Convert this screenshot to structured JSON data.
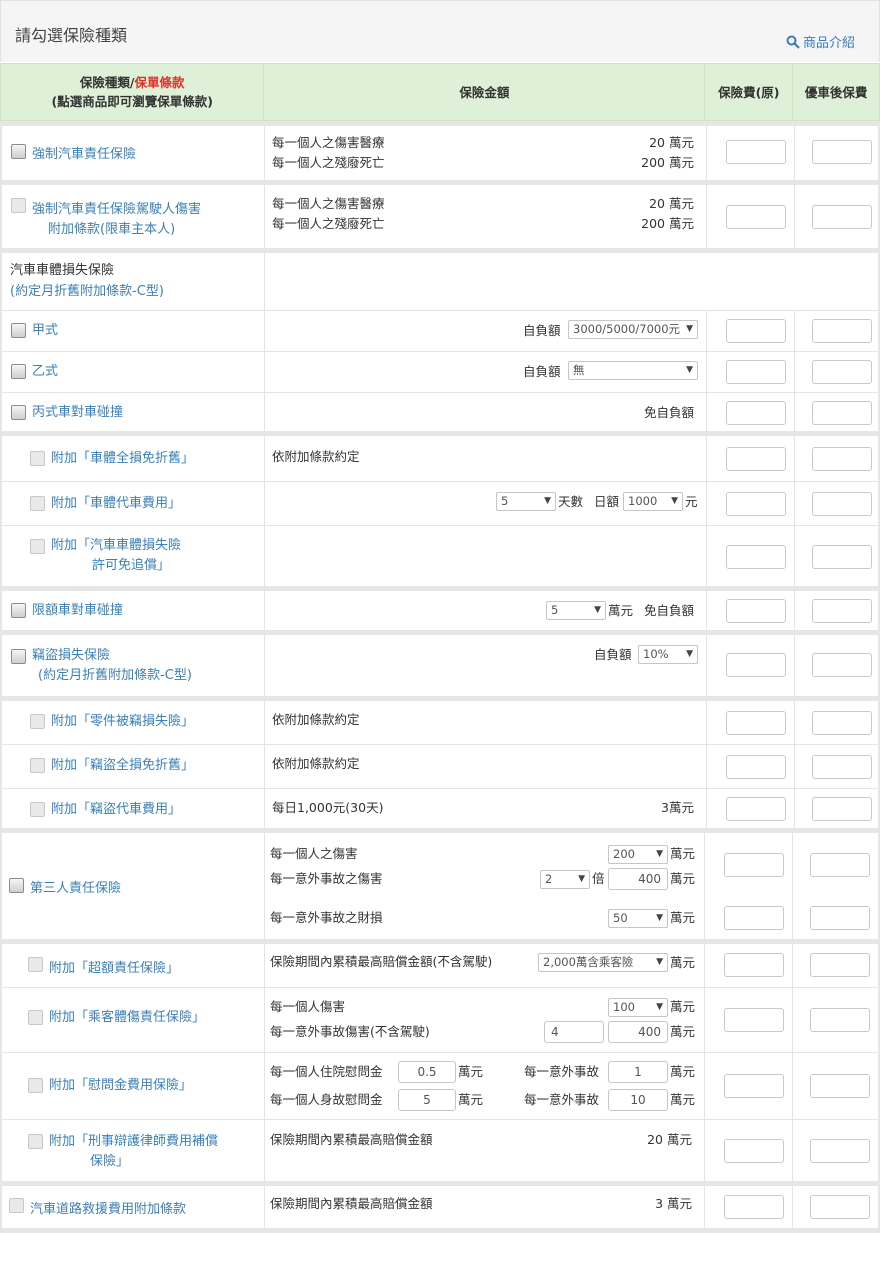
{
  "page": {
    "title": "請勾選保險種類",
    "product_link": "商品介紹"
  },
  "columns": {
    "type_a": "保險種類/",
    "type_b": "保單條款",
    "type_c": "(點選商品即可瀏覽保單條款)",
    "amount": "保險金額",
    "premium": "保險費(原)",
    "discount": "優車後保費"
  },
  "rows": {
    "compulsory": {
      "label": "強制汽車責任保險",
      "line1": "每一個人之傷害醫療",
      "val1": "20 萬元",
      "line2": "每一個人之殘廢死亡",
      "val2": "200 萬元"
    },
    "driver": {
      "label1": "強制汽車責任保險駕駛人傷害",
      "label2": "附加條款(限車主本人)",
      "line1": "每一個人之傷害醫療",
      "val1": "20 萬元",
      "line2": "每一個人之殘廢死亡",
      "val2": "200 萬元"
    },
    "damage": {
      "title": "汽車車體損失保險",
      "subtitle": "(約定月折舊附加條款-C型)"
    },
    "type_a": {
      "label": "甲式",
      "ded_label": "自負額",
      "ded_value": "3000/5000/7000元"
    },
    "type_b": {
      "label": "乙式",
      "ded_label": "自負額",
      "ded_value": "無"
    },
    "type_c": {
      "label": "丙式車對車碰撞",
      "note": "免自負額"
    },
    "addon_full_loss": {
      "label": "附加「車體全損免折舊」",
      "note": "依附加條款約定"
    },
    "addon_rental": {
      "label": "附加「車體代車費用」",
      "days": "5",
      "days_label": "天數",
      "daily_label": "日額",
      "daily": "1000",
      "unit": "元"
    },
    "addon_waiver": {
      "label1": "附加「汽車車體損失險",
      "label2": "許可免追償」"
    },
    "limited": {
      "label": "限額車對車碰撞",
      "amount": "5",
      "unit": "萬元",
      "note": "免自負額"
    },
    "theft": {
      "label1": "竊盜損失保險",
      "label2": "(約定月折舊附加條款-C型)",
      "ded_label": "自負額",
      "ded_value": "10%"
    },
    "addon_parts": {
      "label": "附加「零件被竊損失險」",
      "note": "依附加條款約定"
    },
    "addon_theft_full": {
      "label": "附加「竊盜全損免折舊」",
      "note": "依附加條款約定"
    },
    "addon_theft_rental": {
      "label": "附加「竊盜代車費用」",
      "note": "每日1,000元(30天)",
      "amount": "3萬元"
    },
    "third_party": {
      "label": "第三人責任保險",
      "line1": "每一個人之傷害",
      "val1": "200",
      "line2": "每一意外事故之傷害",
      "multiplier": "2",
      "times": "倍",
      "val2": "400",
      "line3": "每一意外事故之財損",
      "val3": "50",
      "unit": "萬元"
    },
    "excess": {
      "label": "附加「超額責任保險」",
      "line": "保險期間內累積最高賠償金額(不含駕駛)",
      "value": "2,000萬含乘客險",
      "unit": "萬元"
    },
    "passenger": {
      "label": "附加「乘客體傷責任保險」",
      "line1": "每一個人傷害",
      "val1": "100",
      "line2": "每一意外事故傷害(不含駕駛)",
      "val2a": "4",
      "val2b": "400",
      "unit": "萬元"
    },
    "consolation": {
      "label": "附加「慰問金費用保險」",
      "line1": "每一個人住院慰問金",
      "val1": "0.5",
      "line2": "每一個人身故慰問金",
      "val2": "5",
      "acc_label": "每一意外事故",
      "acc1": "1",
      "acc2": "10",
      "unit": "萬元"
    },
    "legal": {
      "label1": "附加「刑事辯護律師費用補償",
      "label2": "保險」",
      "line": "保險期間內累積最高賠償金額",
      "value": "20 萬元"
    },
    "roadside": {
      "label": "汽車道路救援費用附加條款",
      "line": "保險期間內累積最高賠償金額",
      "value": "3 萬元"
    }
  }
}
